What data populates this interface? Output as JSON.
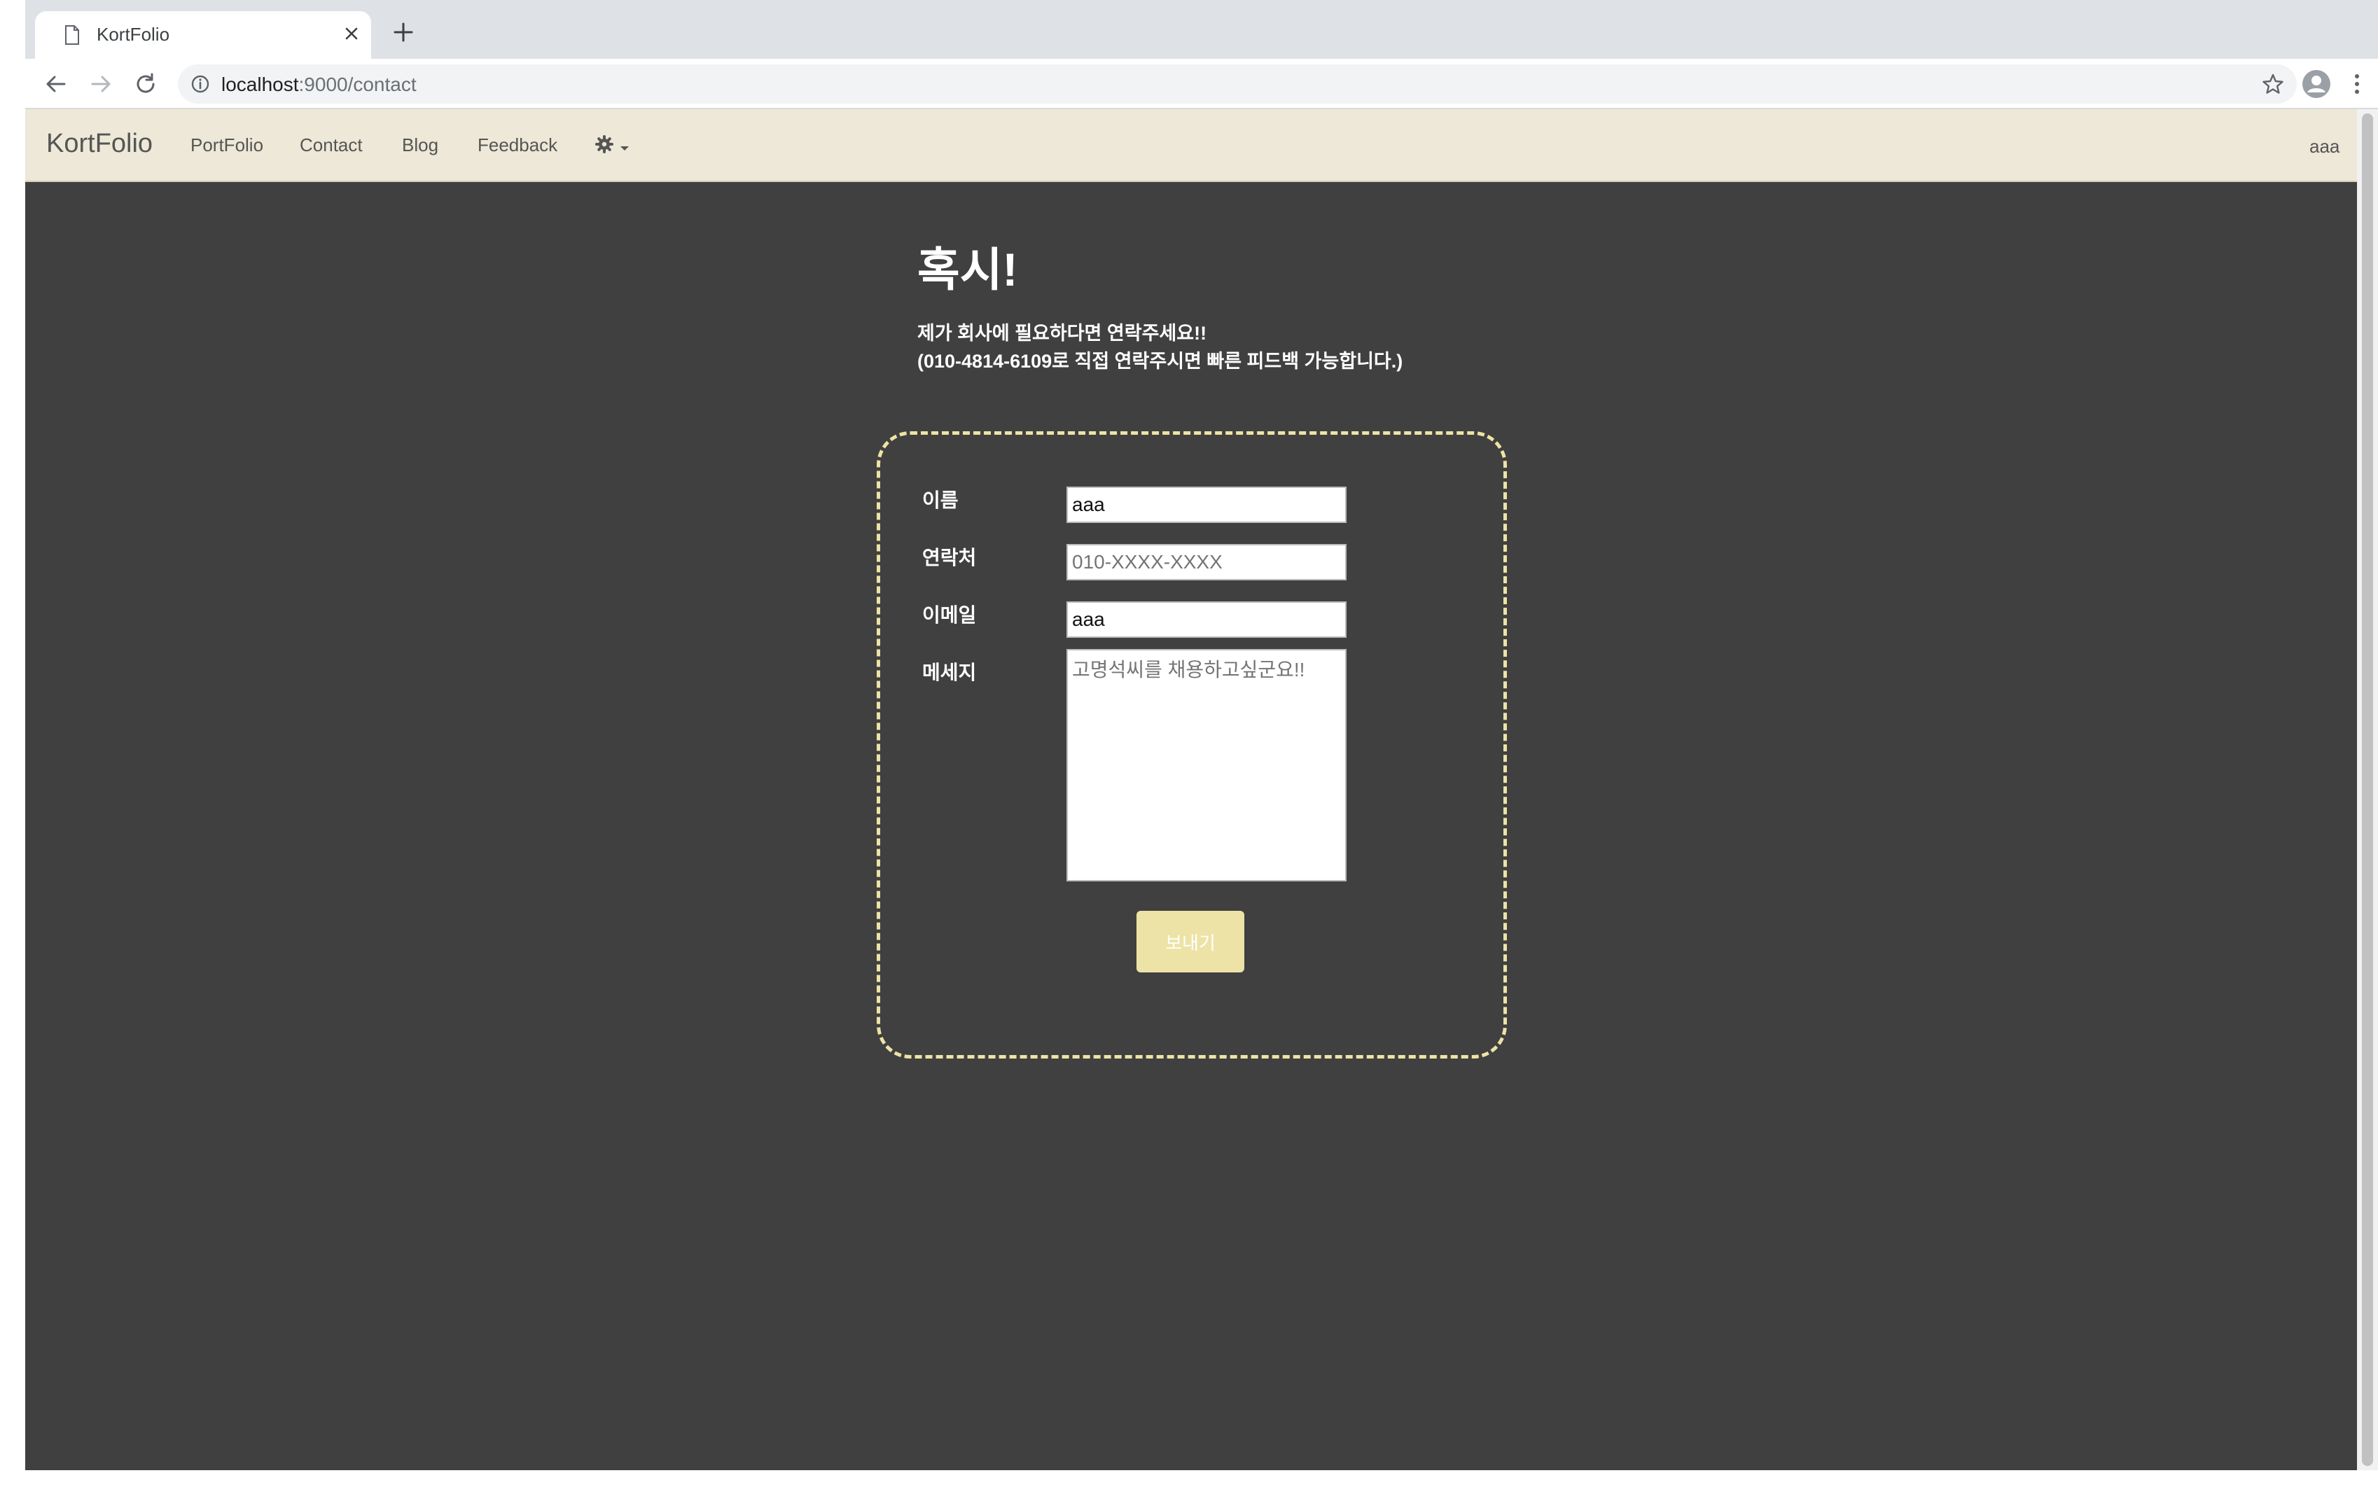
{
  "browser": {
    "tab_title": "KortFolio",
    "url_host": "localhost",
    "url_rest": ":9000/contact"
  },
  "navbar": {
    "brand": "KortFolio",
    "links": [
      "PortFolio",
      "Contact",
      "Blog",
      "Feedback"
    ],
    "settings_icon": "gear-icon",
    "user": "aaa"
  },
  "contact": {
    "heading": "혹시!",
    "line1": "제가 회사에 필요하다면 연락주세요!!",
    "line2": "(010-4814-6109로 직접 연락주시면 빠른 피드백 가능합니다.)",
    "form": {
      "name_label": "이름",
      "name_value": "aaa",
      "phone_label": "연락처",
      "phone_placeholder": "010-XXXX-XXXX",
      "email_label": "이메일",
      "email_value": "aaa",
      "message_label": "메세지",
      "message_placeholder": "고명석씨를 채용하고싶군요!!",
      "submit_label": "보내기"
    }
  },
  "colors": {
    "page_background": "#404040",
    "navbar_background": "#ede8d7",
    "accent": "#ede3a6"
  }
}
